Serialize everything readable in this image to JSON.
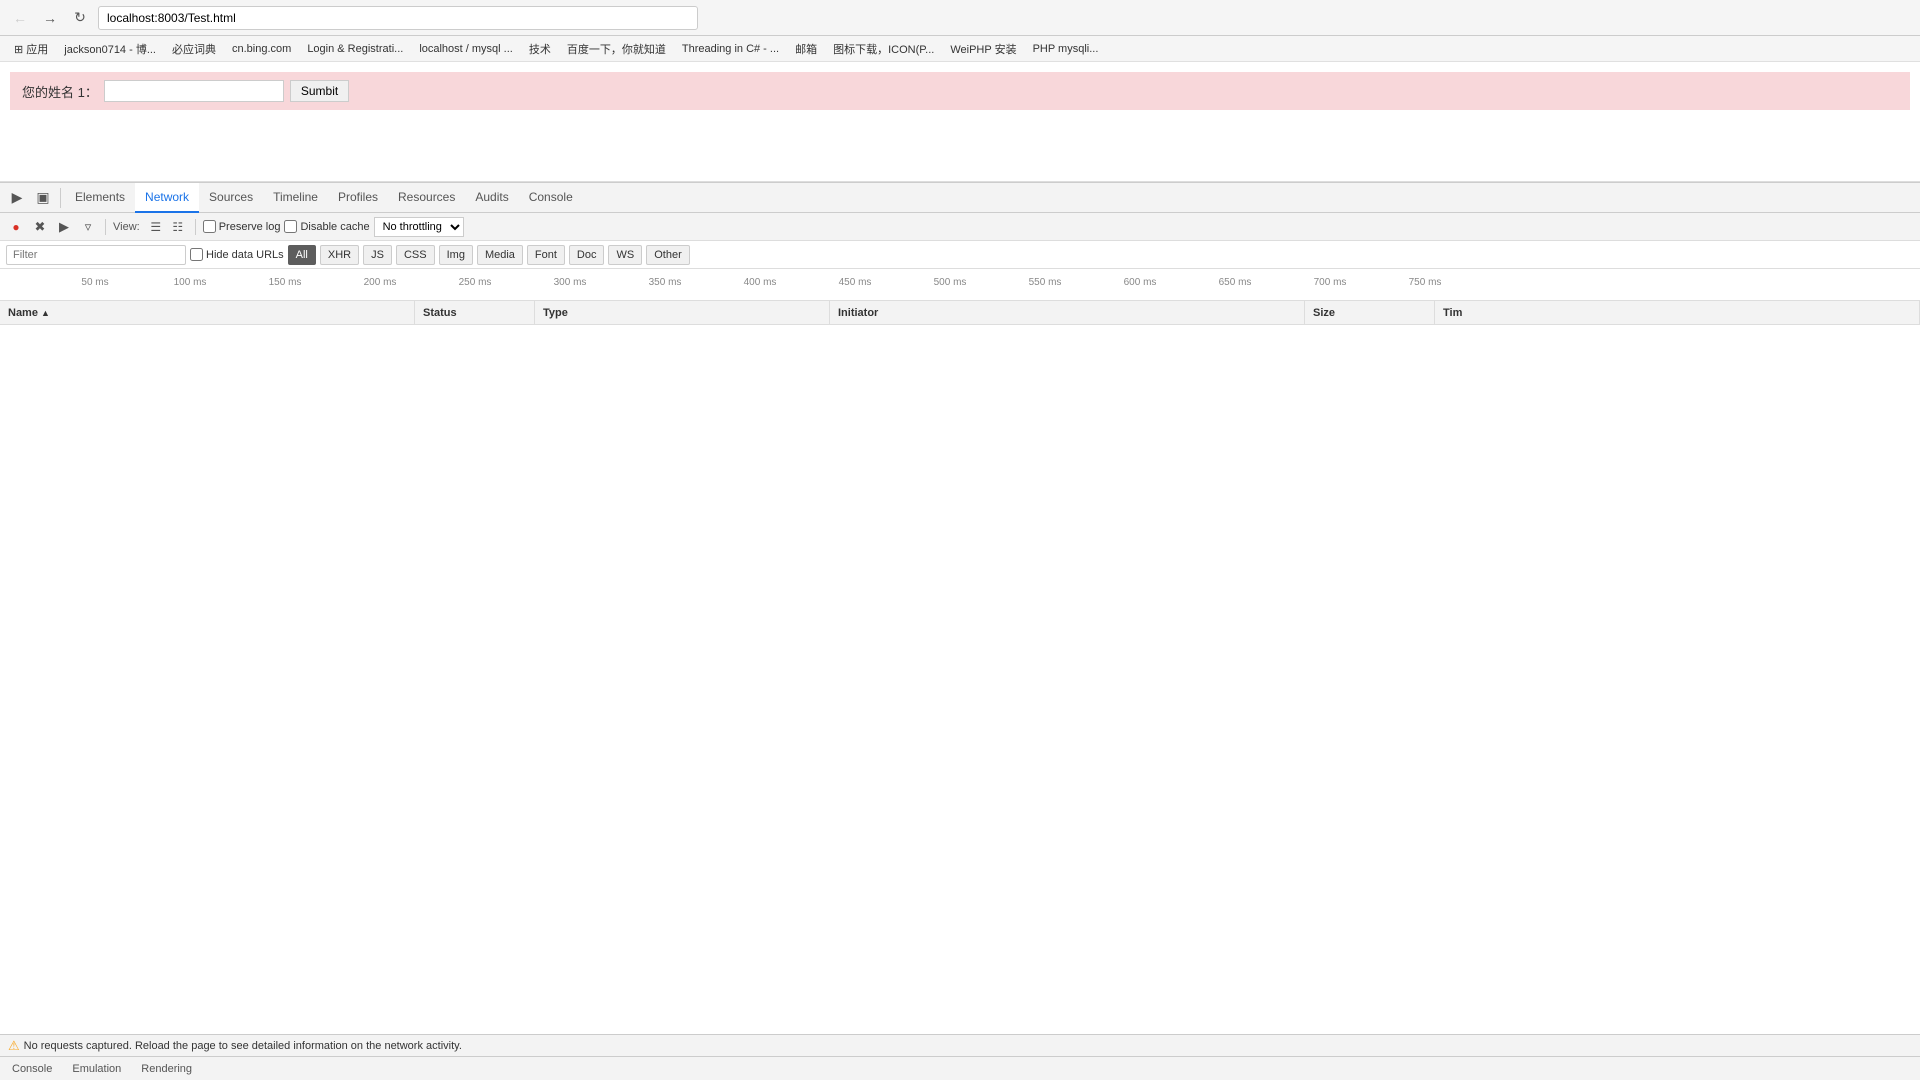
{
  "browser": {
    "url": "localhost:8003/Test.html",
    "nav_back_label": "←",
    "nav_forward_label": "→",
    "nav_refresh_label": "↻"
  },
  "bookmarks": [
    {
      "label": "应用",
      "icon": "⊞"
    },
    {
      "label": "jackson0714 - 博..."
    },
    {
      "label": "必应词典"
    },
    {
      "label": "cn.bing.com"
    },
    {
      "label": "Login & Registrati..."
    },
    {
      "label": "localhost / mysql ..."
    },
    {
      "label": "技术"
    },
    {
      "label": "百度一下，你就知道"
    },
    {
      "label": "Threading in C# - ..."
    },
    {
      "label": "邮箱"
    },
    {
      "label": "图标下载，ICON(P..."
    },
    {
      "label": "WeiPHP 安装"
    },
    {
      "label": "PHP mysqli..."
    }
  ],
  "page": {
    "form_label": "您的姓名 1：",
    "form_input_value": "",
    "form_submit_label": "Sumbit"
  },
  "devtools": {
    "tabs": [
      {
        "label": "Elements"
      },
      {
        "label": "Network",
        "active": true
      },
      {
        "label": "Sources"
      },
      {
        "label": "Timeline"
      },
      {
        "label": "Profiles"
      },
      {
        "label": "Resources"
      },
      {
        "label": "Audits"
      },
      {
        "label": "Console"
      }
    ],
    "toolbar": {
      "view_label": "View:",
      "preserve_log_label": "Preserve log",
      "disable_cache_label": "Disable cache",
      "throttle_option": "No throttling"
    },
    "filter": {
      "placeholder": "Filter",
      "hide_data_urls_label": "Hide data URLs",
      "type_filters": [
        "All",
        "XHR",
        "JS",
        "CSS",
        "Img",
        "Media",
        "Font",
        "Doc",
        "WS",
        "Other"
      ]
    },
    "timeline": {
      "ticks": [
        "50 ms",
        "100 ms",
        "150 ms",
        "200 ms",
        "250 ms",
        "300 ms",
        "350 ms",
        "400 ms",
        "450 ms",
        "500 ms",
        "550 ms",
        "600 ms",
        "650 ms",
        "700 ms",
        "750 ms"
      ]
    },
    "table": {
      "columns": [
        {
          "label": "Name",
          "sort_arrow": "▲"
        },
        {
          "label": "Status"
        },
        {
          "label": "Type"
        },
        {
          "label": "Initiator"
        },
        {
          "label": "Size"
        },
        {
          "label": "Tim"
        }
      ]
    },
    "statusbar": {
      "message": "No requests captured. Reload the page to see detailed information on the network activity."
    },
    "bottom_tabs": [
      "Console",
      "Emulation",
      "Rendering"
    ]
  }
}
